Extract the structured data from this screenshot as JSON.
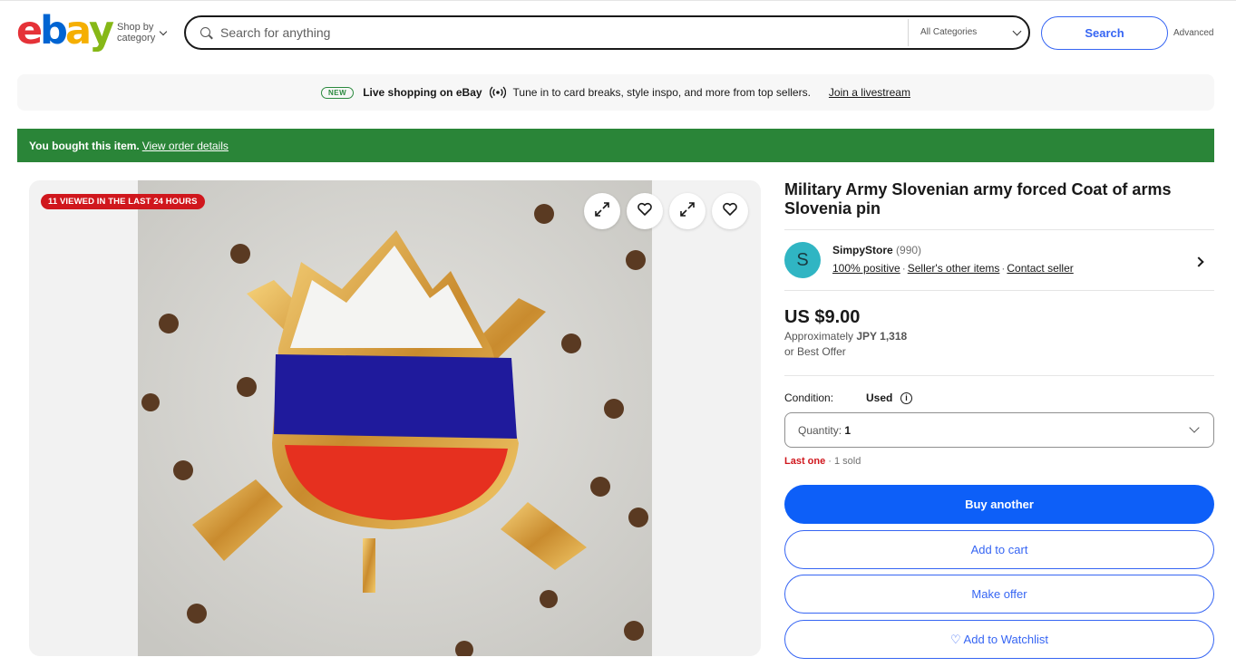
{
  "header": {
    "logo": [
      "e",
      "b",
      "a",
      "y"
    ],
    "shop_by_line1": "Shop by",
    "shop_by_line2": "category",
    "search_placeholder": "Search for anything",
    "category_select": "All Categories",
    "search_button": "Search",
    "advanced_link": "Advanced"
  },
  "live_banner": {
    "badge": "NEW",
    "title": "Live shopping on eBay",
    "description": "Tune in to card breaks, style inspo, and more from top sellers.",
    "link": "Join a livestream"
  },
  "purchase_banner": {
    "text": "You bought this item.",
    "link": "View order details"
  },
  "gallery": {
    "viewed_badge": "11 VIEWED IN THE LAST 24 HOURS",
    "icons": [
      "expand-icon",
      "heart-icon",
      "expand-icon",
      "heart-icon"
    ]
  },
  "item": {
    "title": "Military Army Slovenian army forced Coat of arms Slovenia pin",
    "seller": {
      "avatar_letter": "S",
      "name": "SimpyStore",
      "feedback_count": "(990)",
      "positive": "100% positive",
      "other_items": "Seller's other items",
      "contact": "Contact seller"
    },
    "price": "US $9.00",
    "approx_prefix": "Approximately",
    "approx_value": "JPY 1,318",
    "best_offer": "or Best Offer",
    "condition_label": "Condition:",
    "condition_value": "Used",
    "quantity_label": "Quantity:",
    "quantity_value": "1",
    "stock_last": "Last one",
    "stock_sold": " · 1 sold",
    "buttons": {
      "buy_another": "Buy another",
      "add_to_cart": "Add to cart",
      "make_offer": "Make offer",
      "add_to_watchlist": "♡ Add to Watchlist"
    }
  },
  "colors": {
    "brand_blue": "#3665f3",
    "primary_button": "#0d5ff8",
    "purchase_green": "#2a8538",
    "alert_red": "#d0171d",
    "avatar_teal": "#30b5c3"
  }
}
